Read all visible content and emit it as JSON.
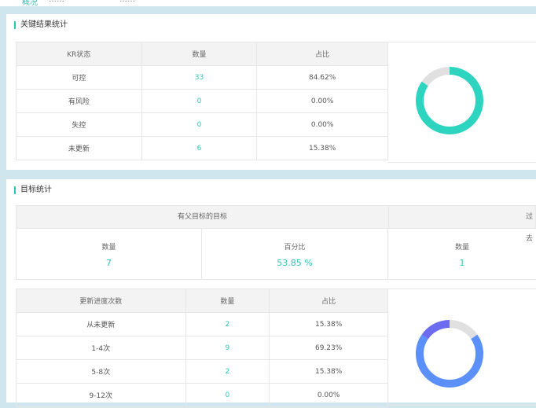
{
  "tabs": [
    "概况",
    "……",
    "……"
  ],
  "kr_section": {
    "title": "关键结果统计",
    "headers": [
      "KR状态",
      "数量",
      "占比"
    ],
    "rows": [
      {
        "status": "可控",
        "count": "33",
        "ratio": "84.62%"
      },
      {
        "status": "有风险",
        "count": "0",
        "ratio": "0.00%"
      },
      {
        "status": "失控",
        "count": "0",
        "ratio": "0.00%"
      },
      {
        "status": "未更新",
        "count": "6",
        "ratio": "15.38%"
      }
    ],
    "donut": {
      "segments": [
        {
          "value": 84.62,
          "color": "#2dd4bf"
        },
        {
          "value": 0,
          "color": "#f5a623"
        },
        {
          "value": 0,
          "color": "#e74c3c"
        },
        {
          "value": 15.38,
          "color": "#e0e0e0"
        }
      ]
    }
  },
  "goal_section": {
    "title": "目标统计",
    "parent_header": "有父目标的目标",
    "overdue_header": "过去",
    "count_label": "数量",
    "count_value": "7",
    "percent_label": "百分比",
    "percent_value": "53.85 %",
    "overdue_count_label": "数量",
    "overdue_count_value": "1",
    "update_table": {
      "headers": [
        "更新进度次数",
        "数量",
        "占比"
      ],
      "rows": [
        {
          "range": "从未更新",
          "count": "2",
          "ratio": "15.38%"
        },
        {
          "range": "1-4次",
          "count": "9",
          "ratio": "69.23%"
        },
        {
          "range": "5-8次",
          "count": "2",
          "ratio": "15.38%"
        },
        {
          "range": "9-12次",
          "count": "0",
          "ratio": "0.00%"
        }
      ]
    },
    "donut": {
      "segments": [
        {
          "value": 15.38,
          "color": "#e0e0e0"
        },
        {
          "value": 69.23,
          "color": "#5b8ff9"
        },
        {
          "value": 15.38,
          "color": "#6c6cf0"
        },
        {
          "value": 0,
          "color": "#2dd4bf"
        }
      ]
    }
  }
}
